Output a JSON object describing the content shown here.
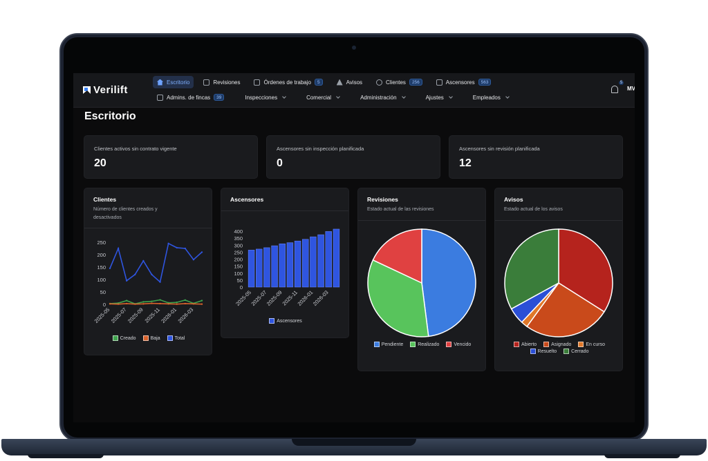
{
  "app": {
    "brand": "Verilift",
    "user_initials": "MV",
    "notifications_count": "5"
  },
  "nav_row1": [
    {
      "label": "Escritorio",
      "active": true,
      "badge": ""
    },
    {
      "label": "Revisiones",
      "badge": ""
    },
    {
      "label": "Órdenes de trabajo",
      "badge": "5"
    },
    {
      "label": "Avisos",
      "badge": ""
    },
    {
      "label": "Clientes",
      "badge": "256"
    },
    {
      "label": "Ascensores",
      "badge": "563"
    }
  ],
  "nav_row2": [
    {
      "label": "Admins. de fincas",
      "badge": "39"
    },
    {
      "label": "Inspecciones",
      "dropdown": true
    },
    {
      "label": "Comercial",
      "dropdown": true
    },
    {
      "label": "Administración",
      "dropdown": true
    },
    {
      "label": "Ajustes",
      "dropdown": true
    },
    {
      "label": "Empleados",
      "dropdown": true
    }
  ],
  "page": {
    "title": "Escritorio"
  },
  "stats": [
    {
      "label": "Clientes activos sin contrato vigente",
      "value": "20"
    },
    {
      "label": "Ascensores sin inspección planificada",
      "value": "0"
    },
    {
      "label": "Ascensores sin revisión planificada",
      "value": "12"
    }
  ],
  "cards": {
    "clientes": {
      "title": "Clientes",
      "subtitle_1": "Número de clientes creados y",
      "subtitle_2": "desactivados"
    },
    "ascensores": {
      "title": "Ascensores"
    },
    "revisiones": {
      "title": "Revisiones",
      "subtitle": "Estado actual de las revisiones"
    },
    "avisos": {
      "title": "Avisos",
      "subtitle": "Estado actual de los avisos"
    }
  },
  "chart_data": [
    {
      "type": "line",
      "title": "Clientes",
      "x": [
        "2025-05",
        "2025-06",
        "2025-07",
        "2025-08",
        "2025-09",
        "2025-10",
        "2025-11",
        "2025-12",
        "2026-01",
        "2026-02",
        "2026-03",
        "2026-04"
      ],
      "x_tick_labels": [
        "2025-05",
        "2025-07",
        "2025-09",
        "2025-11",
        "2026-01",
        "2026-03"
      ],
      "y_ticks": [
        0,
        50,
        100,
        150,
        200,
        250
      ],
      "ylim": [
        0,
        250
      ],
      "series": [
        {
          "name": "Creado",
          "color": "#3fa34d",
          "values": [
            3,
            5,
            15,
            2,
            10,
            12,
            18,
            6,
            8,
            17,
            4,
            15
          ]
        },
        {
          "name": "Baja",
          "color": "#d9622b",
          "values": [
            2,
            1,
            3,
            1,
            2,
            4,
            3,
            2,
            1,
            3,
            2,
            1
          ]
        },
        {
          "name": "Total",
          "color": "#2f55e0",
          "values": [
            145,
            225,
            95,
            120,
            175,
            120,
            90,
            245,
            228,
            225,
            180,
            210
          ]
        }
      ],
      "legend_position": "bottom"
    },
    {
      "type": "bar",
      "title": "Ascensores",
      "categories": [
        "2025-05",
        "2025-06",
        "2025-07",
        "2025-08",
        "2025-09",
        "2025-10",
        "2025-11",
        "2025-12",
        "2026-01",
        "2026-02",
        "2026-03",
        "2026-04"
      ],
      "x_tick_labels": [
        "2025-05",
        "2025-07",
        "2025-09",
        "2025-11",
        "2026-01",
        "2026-03"
      ],
      "y_ticks": [
        0,
        50,
        100,
        150,
        200,
        250,
        300,
        350,
        400
      ],
      "ylim": [
        0,
        400
      ],
      "series": [
        {
          "name": "Ascensores",
          "color": "#2f55e0",
          "values": [
            265,
            272,
            282,
            296,
            310,
            318,
            330,
            342,
            360,
            375,
            398,
            415
          ]
        }
      ],
      "legend_position": "bottom"
    },
    {
      "type": "pie",
      "title": "Revisiones",
      "labels": [
        "Pendiente",
        "Realizado",
        "Vencido"
      ],
      "values": [
        48,
        34,
        18
      ],
      "colors": [
        "#3b7ce0",
        "#58c45c",
        "#e04141"
      ],
      "legend_position": "bottom"
    },
    {
      "type": "pie",
      "title": "Avisos",
      "labels": [
        "Abierto",
        "Asignado",
        "En curso",
        "Resuelto",
        "Cerrado"
      ],
      "values": [
        34,
        26,
        2,
        5,
        33
      ],
      "colors": [
        "#b5231d",
        "#c94a1b",
        "#e0782a",
        "#2b4fd6",
        "#3a7d3a"
      ],
      "legend_position": "bottom"
    }
  ]
}
